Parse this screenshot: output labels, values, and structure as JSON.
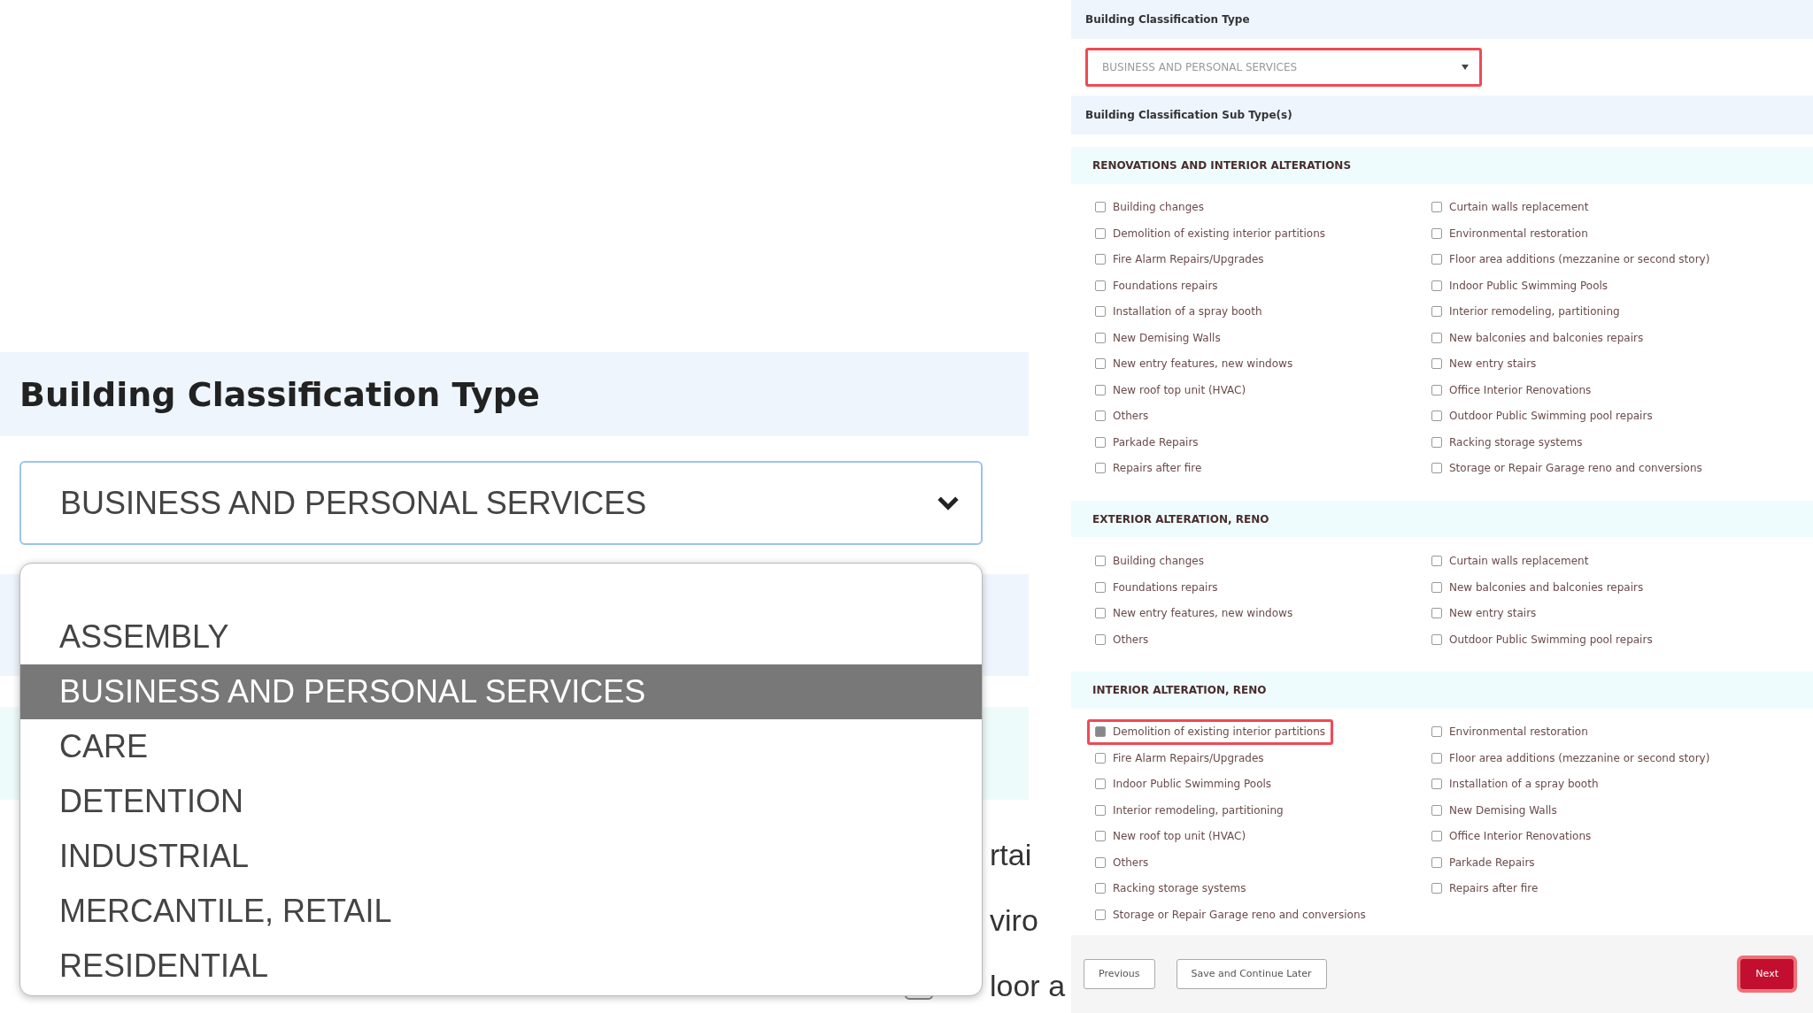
{
  "left": {
    "heading": "Building Classification Type",
    "select": {
      "value": "BUSINESS AND PERSONAL SERVICES"
    },
    "dropdown": {
      "options": [
        {
          "label": "ASSEMBLY",
          "selected": false
        },
        {
          "label": "BUSINESS AND PERSONAL SERVICES",
          "selected": true
        },
        {
          "label": "CARE",
          "selected": false
        },
        {
          "label": "DETENTION",
          "selected": false
        },
        {
          "label": "INDUSTRIAL",
          "selected": false
        },
        {
          "label": "MERCANTILE, RETAIL",
          "selected": false
        },
        {
          "label": "RESIDENTIAL",
          "selected": false
        }
      ]
    },
    "background_rows": [
      {
        "text": "rtai",
        "kind": "text"
      },
      {
        "text": "viro",
        "kind": "text"
      },
      {
        "text": "loor a",
        "kind": "checkbox"
      }
    ]
  },
  "right": {
    "type_heading": "Building Classification Type",
    "select": {
      "value": "BUSINESS AND PERSONAL SERVICES",
      "highlighted": true
    },
    "subtype_heading": "Building Classification Sub Type(s)",
    "sections": [
      {
        "title": "RENOVATIONS AND INTERIOR ALTERATIONS",
        "left_column": [
          {
            "label": "Building changes",
            "checked": false,
            "highlighted": false
          },
          {
            "label": "Demolition of existing interior partitions",
            "checked": false,
            "highlighted": false
          },
          {
            "label": "Fire Alarm Repairs/Upgrades",
            "checked": false,
            "highlighted": false
          },
          {
            "label": "Foundations repairs",
            "checked": false,
            "highlighted": false
          },
          {
            "label": "Installation of a spray booth",
            "checked": false,
            "highlighted": false
          },
          {
            "label": "New Demising Walls",
            "checked": false,
            "highlighted": false
          },
          {
            "label": "New entry features, new windows",
            "checked": false,
            "highlighted": false
          },
          {
            "label": "New roof top unit (HVAC)",
            "checked": false,
            "highlighted": false
          },
          {
            "label": "Others",
            "checked": false,
            "highlighted": false
          },
          {
            "label": "Parkade Repairs",
            "checked": false,
            "highlighted": false
          },
          {
            "label": "Repairs after fire",
            "checked": false,
            "highlighted": false
          }
        ],
        "right_column": [
          {
            "label": "Curtain walls replacement",
            "checked": false,
            "highlighted": false
          },
          {
            "label": "Environmental restoration",
            "checked": false,
            "highlighted": false
          },
          {
            "label": "Floor area additions (mezzanine or second story)",
            "checked": false,
            "highlighted": false
          },
          {
            "label": "Indoor Public Swimming Pools",
            "checked": false,
            "highlighted": false
          },
          {
            "label": "Interior remodeling, partitioning",
            "checked": false,
            "highlighted": false
          },
          {
            "label": "New balconies and balconies repairs",
            "checked": false,
            "highlighted": false
          },
          {
            "label": "New entry stairs",
            "checked": false,
            "highlighted": false
          },
          {
            "label": "Office Interior Renovations",
            "checked": false,
            "highlighted": false
          },
          {
            "label": "Outdoor Public Swimming pool repairs",
            "checked": false,
            "highlighted": false
          },
          {
            "label": "Racking storage systems",
            "checked": false,
            "highlighted": false
          },
          {
            "label": "Storage or Repair Garage reno and conversions",
            "checked": false,
            "highlighted": false
          }
        ]
      },
      {
        "title": "EXTERIOR ALTERATION, RENO",
        "left_column": [
          {
            "label": "Building changes",
            "checked": false,
            "highlighted": false
          },
          {
            "label": "Foundations repairs",
            "checked": false,
            "highlighted": false
          },
          {
            "label": "New entry features, new windows",
            "checked": false,
            "highlighted": false
          },
          {
            "label": "Others",
            "checked": false,
            "highlighted": false
          }
        ],
        "right_column": [
          {
            "label": "Curtain walls replacement",
            "checked": false,
            "highlighted": false
          },
          {
            "label": "New balconies and balconies repairs",
            "checked": false,
            "highlighted": false
          },
          {
            "label": "New entry stairs",
            "checked": false,
            "highlighted": false
          },
          {
            "label": "Outdoor Public Swimming pool repairs",
            "checked": false,
            "highlighted": false
          }
        ]
      },
      {
        "title": "INTERIOR ALTERATION, RENO",
        "left_column": [
          {
            "label": "Demolition of existing interior partitions",
            "checked": true,
            "highlighted": true
          },
          {
            "label": "Fire Alarm Repairs/Upgrades",
            "checked": false,
            "highlighted": false
          },
          {
            "label": "Indoor Public Swimming Pools",
            "checked": false,
            "highlighted": false
          },
          {
            "label": "Interior remodeling, partitioning",
            "checked": false,
            "highlighted": false
          },
          {
            "label": "New roof top unit (HVAC)",
            "checked": false,
            "highlighted": false
          },
          {
            "label": "Others",
            "checked": false,
            "highlighted": false
          },
          {
            "label": "Racking storage systems",
            "checked": false,
            "highlighted": false
          },
          {
            "label": "Storage or Repair Garage reno and conversions",
            "checked": false,
            "highlighted": false
          }
        ],
        "right_column": [
          {
            "label": "Environmental restoration",
            "checked": false,
            "highlighted": false
          },
          {
            "label": "Floor area additions (mezzanine or second story)",
            "checked": false,
            "highlighted": false
          },
          {
            "label": "Installation of a spray booth",
            "checked": false,
            "highlighted": false
          },
          {
            "label": "New Demising Walls",
            "checked": false,
            "highlighted": false
          },
          {
            "label": "Office Interior Renovations",
            "checked": false,
            "highlighted": false
          },
          {
            "label": "Parkade Repairs",
            "checked": false,
            "highlighted": false
          },
          {
            "label": "Repairs after fire",
            "checked": false,
            "highlighted": false
          }
        ]
      }
    ],
    "buttons": [
      {
        "label": "Previous",
        "kind": "secondary",
        "highlighted": false
      },
      {
        "label": "Save and Continue Later",
        "kind": "secondary",
        "highlighted": false
      },
      {
        "label": "Next",
        "kind": "primary",
        "highlighted": true
      }
    ]
  }
}
